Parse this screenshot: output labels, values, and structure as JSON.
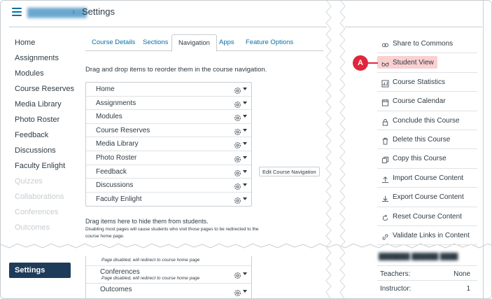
{
  "header": {
    "course_name": "",
    "separator": "›",
    "page_title": "Settings"
  },
  "left_nav": {
    "items": [
      {
        "label": "Home",
        "faded": false
      },
      {
        "label": "Assignments",
        "faded": false
      },
      {
        "label": "Modules",
        "faded": false
      },
      {
        "label": "Course Reserves",
        "faded": false
      },
      {
        "label": "Media Library",
        "faded": false
      },
      {
        "label": "Photo Roster",
        "faded": false
      },
      {
        "label": "Feedback",
        "faded": false
      },
      {
        "label": "Discussions",
        "faded": false
      },
      {
        "label": "Faculty Enlight",
        "faded": false
      },
      {
        "label": "Quizzes",
        "faded": true
      },
      {
        "label": "Collaborations",
        "faded": true
      },
      {
        "label": "Conferences",
        "faded": true
      },
      {
        "label": "Outcomes",
        "faded": true
      }
    ],
    "active_label": "Settings"
  },
  "tabs": [
    {
      "label": "Course Details",
      "active": false
    },
    {
      "label": "Sections",
      "active": false
    },
    {
      "label": "Navigation",
      "active": true
    },
    {
      "label": "Apps",
      "active": false
    },
    {
      "label": "Feature Options",
      "active": false
    }
  ],
  "navigation": {
    "instruction": "Drag and drop items to reorder them in the course navigation.",
    "visible_items": [
      "Home",
      "Assignments",
      "Modules",
      "Course Reserves",
      "Media Library",
      "Photo Roster",
      "Feedback",
      "Discussions",
      "Faculty Enlight"
    ],
    "tooltip": "Edit Course Navigation",
    "hide_title": "Drag items here to hide them from students.",
    "hide_note": "Disabling most pages will cause students who visit those pages to be redirected to the course home page.",
    "hidden_items": [
      {
        "label": "",
        "note": "Page disabled, will redirect to course home page"
      },
      {
        "label": "Conferences",
        "note": "Page disabled, will redirect to course home page"
      },
      {
        "label": "Outcomes",
        "note": ""
      }
    ]
  },
  "sidebar": {
    "items": [
      {
        "label": "Share to Commons",
        "icon": "commons-icon",
        "highlight": false
      },
      {
        "label": "Student View",
        "icon": "glasses-icon",
        "highlight": true
      },
      {
        "label": "Course Statistics",
        "icon": "stats-icon",
        "highlight": false
      },
      {
        "label": "Course Calendar",
        "icon": "calendar-icon",
        "highlight": false
      },
      {
        "label": "Conclude this Course",
        "icon": "lock-icon",
        "highlight": false
      },
      {
        "label": "Delete this Course",
        "icon": "trash-icon",
        "highlight": false
      },
      {
        "label": "Copy this Course",
        "icon": "copy-icon",
        "highlight": false
      },
      {
        "label": "Import Course Content",
        "icon": "import-icon",
        "highlight": false
      },
      {
        "label": "Export Course Content",
        "icon": "export-icon",
        "highlight": false
      },
      {
        "label": "Reset Course Content",
        "icon": "reset-icon",
        "highlight": false
      },
      {
        "label": "Validate Links in Content",
        "icon": "link-icon",
        "highlight": false
      }
    ],
    "callout": "A",
    "stats": [
      {
        "key": "Teachers:",
        "value": "None"
      },
      {
        "key": "Instructor:",
        "value": "1"
      }
    ]
  },
  "colors": {
    "link": "#0770a3",
    "text": "#2d3b45",
    "nav_active_bg": "#1e3b5a",
    "highlight": "#fbd0d0",
    "callout": "#e0263b"
  }
}
